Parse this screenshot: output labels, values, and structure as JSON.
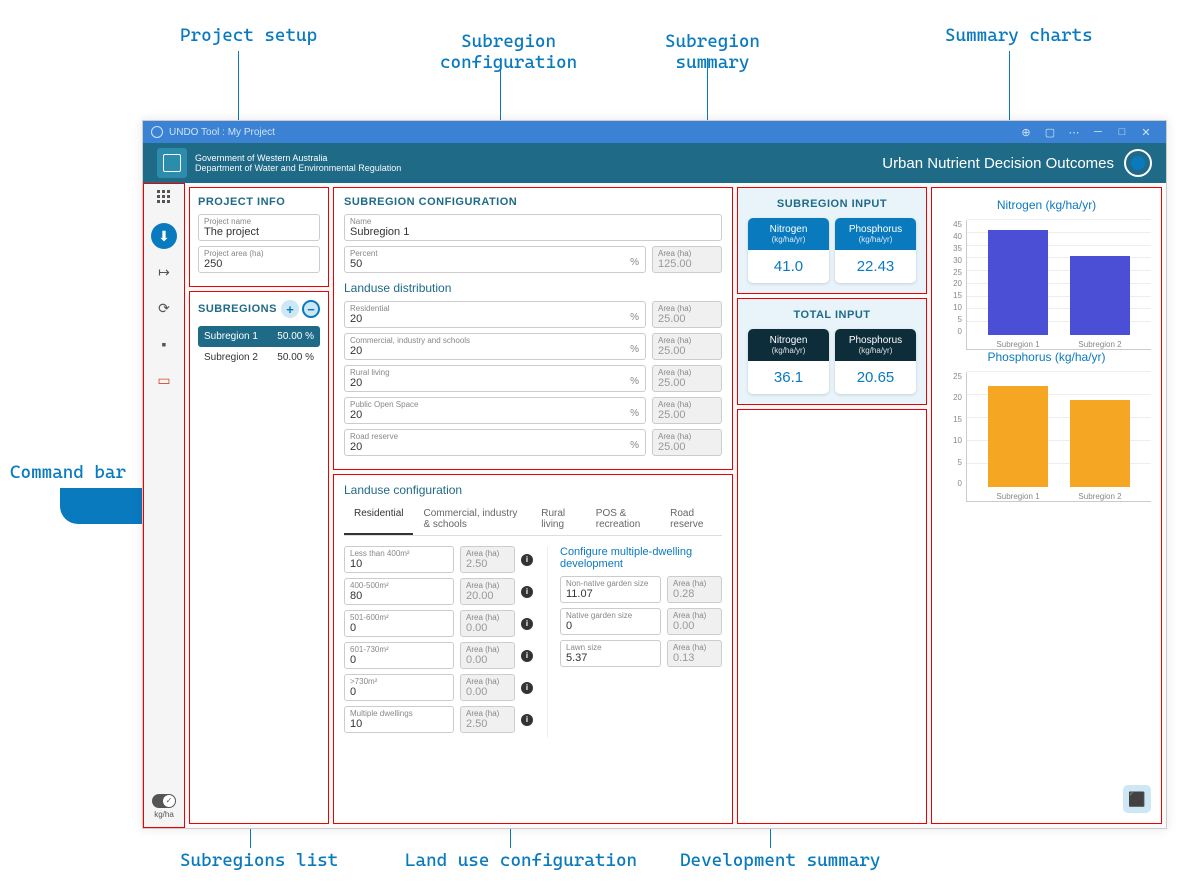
{
  "annotations": {
    "project_setup": "Project setup",
    "subregion_configuration": "Subregion\nconfiguration",
    "subregion_summary": "Subregion\nsummary",
    "summary_charts": "Summary charts",
    "command_bar": "Command bar",
    "subregions_list": "Subregions list",
    "land_use_configuration": "Land use configuration",
    "development_summary": "Development summary"
  },
  "titlebar": {
    "title": "UNDO Tool : My Project"
  },
  "banner": {
    "gov1": "Government of Western Australia",
    "gov2": "Department of Water and Environmental Regulation",
    "app_title": "Urban Nutrient Decision Outcomes"
  },
  "cmdbar": {
    "toggle_label": "kg/ha"
  },
  "project_info": {
    "title": "PROJECT INFO",
    "name_label": "Project name",
    "name_value": "The project",
    "area_label": "Project area (ha)",
    "area_value": "250"
  },
  "subregions": {
    "title": "SUBREGIONS",
    "items": [
      {
        "name": "Subregion 1",
        "pct": "50.00 %",
        "active": true
      },
      {
        "name": "Subregion 2",
        "pct": "50.00 %",
        "active": false
      }
    ]
  },
  "subregion_conf": {
    "title": "SUBREGION CONFIGURATION",
    "name_label": "Name",
    "name_value": "Subregion 1",
    "percent_label": "Percent",
    "percent_value": "50",
    "area_label": "Area (ha)",
    "area_value": "125.00",
    "landuse_title": "Landuse distribution",
    "landuse": [
      {
        "label": "Residential",
        "pct": "20",
        "area": "25.00"
      },
      {
        "label": "Commercial, industry and schools",
        "pct": "20",
        "area": "25.00"
      },
      {
        "label": "Rural living",
        "pct": "20",
        "area": "25.00"
      },
      {
        "label": "Public Open Space",
        "pct": "20",
        "area": "25.00"
      },
      {
        "label": "Road reserve",
        "pct": "20",
        "area": "25.00"
      }
    ],
    "area_ha": "Area (ha)"
  },
  "landuse_conf": {
    "title": "Landuse configuration",
    "tabs": [
      "Residential",
      "Commercial, industry & schools",
      "Rural living",
      "POS & recreation",
      "Road reserve"
    ],
    "area_ha": "Area (ha)",
    "residential": [
      {
        "label": "Less than 400m²",
        "pct": "10",
        "area": "2.50"
      },
      {
        "label": "400-500m²",
        "pct": "80",
        "area": "20.00"
      },
      {
        "label": "501-600m²",
        "pct": "0",
        "area": "0.00"
      },
      {
        "label": "601-730m²",
        "pct": "0",
        "area": "0.00"
      },
      {
        "label": ">730m²",
        "pct": "0",
        "area": "0.00"
      },
      {
        "label": "Multiple dwellings",
        "pct": "10",
        "area": "2.50"
      }
    ],
    "multi_title": "Configure multiple-dwelling development",
    "multi": [
      {
        "label": "Non-native garden size",
        "pct": "11.07",
        "area": "0.28"
      },
      {
        "label": "Native garden size",
        "pct": "0",
        "area": "0.00"
      },
      {
        "label": "Lawn size",
        "pct": "5.37",
        "area": "0.13"
      }
    ]
  },
  "sub_input": {
    "title": "SUBREGION INPUT",
    "n_label": "Nitrogen",
    "n_unit": "(kg/ha/yr)",
    "n_val": "41.0",
    "p_label": "Phosphorus",
    "p_unit": "(kg/ha/yr)",
    "p_val": "22.43"
  },
  "tot_input": {
    "title": "TOTAL INPUT",
    "n_label": "Nitrogen",
    "n_unit": "(kg/ha/yr)",
    "n_val": "36.1",
    "p_label": "Phosphorus",
    "p_unit": "(kg/ha/yr)",
    "p_val": "20.65"
  },
  "chart_data": [
    {
      "type": "bar",
      "title": "Nitrogen (kg/ha/yr)",
      "categories": [
        "Subregion 1",
        "Subregion 2"
      ],
      "values": [
        41,
        31
      ],
      "ylim": [
        0,
        45
      ],
      "yticks": [
        0,
        5,
        10,
        15,
        20,
        25,
        30,
        35,
        40,
        45
      ],
      "color": "#4a4fd6"
    },
    {
      "type": "bar",
      "title": "Phosphorus (kg/ha/yr)",
      "categories": [
        "Subregion 1",
        "Subregion 2"
      ],
      "values": [
        22,
        19
      ],
      "ylim": [
        0,
        25
      ],
      "yticks": [
        0,
        5,
        10,
        15,
        20,
        25
      ],
      "color": "#f5a623"
    }
  ]
}
